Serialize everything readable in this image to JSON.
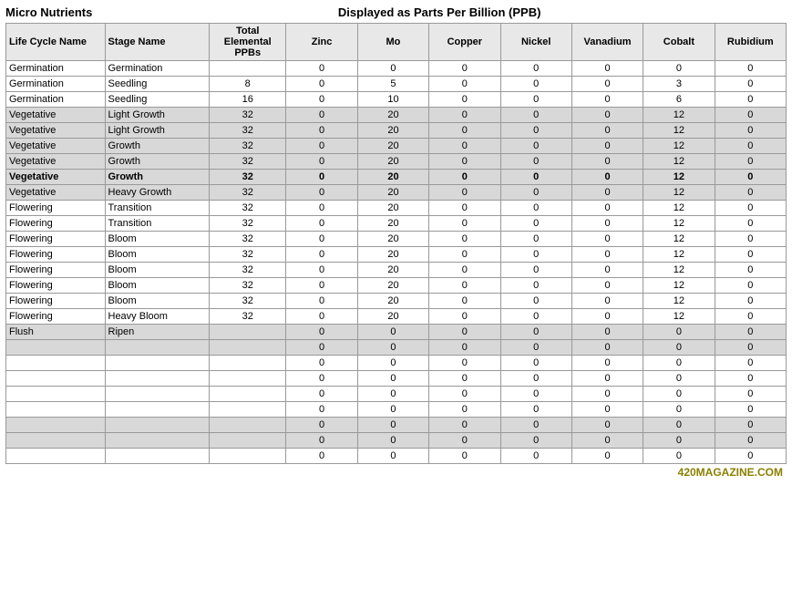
{
  "header": {
    "left_title": "Micro Nutrients",
    "right_title": "Displayed as Parts Per Billion (PPB)"
  },
  "columns": {
    "lifecycle": "Life Cycle Name",
    "stage": "Stage Name",
    "total": "Total Elemental PPBs",
    "zinc": "Zinc",
    "mo": "Mo",
    "copper": "Copper",
    "nickel": "Nickel",
    "vanadium": "Vanadium",
    "cobalt": "Cobalt",
    "rubidium": "Rubidium"
  },
  "rows": [
    {
      "lifecycle": "Germination",
      "stage": "Germination",
      "total": "",
      "zinc": "0",
      "mo": "0",
      "copper": "0",
      "nickel": "0",
      "vanadium": "0",
      "cobalt": "0",
      "rubidium": "0",
      "shade": false
    },
    {
      "lifecycle": "Germination",
      "stage": "Seedling",
      "total": "8",
      "zinc": "0",
      "mo": "5",
      "copper": "0",
      "nickel": "0",
      "vanadium": "0",
      "cobalt": "3",
      "rubidium": "0",
      "shade": false
    },
    {
      "lifecycle": "Germination",
      "stage": "Seedling",
      "total": "16",
      "zinc": "0",
      "mo": "10",
      "copper": "0",
      "nickel": "0",
      "vanadium": "0",
      "cobalt": "6",
      "rubidium": "0",
      "shade": false
    },
    {
      "lifecycle": "Vegetative",
      "stage": "Light Growth",
      "total": "32",
      "zinc": "0",
      "mo": "20",
      "copper": "0",
      "nickel": "0",
      "vanadium": "0",
      "cobalt": "12",
      "rubidium": "0",
      "shade": true
    },
    {
      "lifecycle": "Vegetative",
      "stage": "Light Growth",
      "total": "32",
      "zinc": "0",
      "mo": "20",
      "copper": "0",
      "nickel": "0",
      "vanadium": "0",
      "cobalt": "12",
      "rubidium": "0",
      "shade": true
    },
    {
      "lifecycle": "Vegetative",
      "stage": "Growth",
      "total": "32",
      "zinc": "0",
      "mo": "20",
      "copper": "0",
      "nickel": "0",
      "vanadium": "0",
      "cobalt": "12",
      "rubidium": "0",
      "shade": true
    },
    {
      "lifecycle": "Vegetative",
      "stage": "Growth",
      "total": "32",
      "zinc": "0",
      "mo": "20",
      "copper": "0",
      "nickel": "0",
      "vanadium": "0",
      "cobalt": "12",
      "rubidium": "0",
      "shade": true
    },
    {
      "lifecycle": "Vegetative",
      "stage": "Growth",
      "total": "32",
      "zinc": "0",
      "mo": "20",
      "copper": "0",
      "nickel": "0",
      "vanadium": "0",
      "cobalt": "12",
      "rubidium": "0",
      "shade": true,
      "bold": true
    },
    {
      "lifecycle": "Vegetative",
      "stage": "Heavy Growth",
      "total": "32",
      "zinc": "0",
      "mo": "20",
      "copper": "0",
      "nickel": "0",
      "vanadium": "0",
      "cobalt": "12",
      "rubidium": "0",
      "shade": true
    },
    {
      "lifecycle": "Flowering",
      "stage": "Transition",
      "total": "32",
      "zinc": "0",
      "mo": "20",
      "copper": "0",
      "nickel": "0",
      "vanadium": "0",
      "cobalt": "12",
      "rubidium": "0",
      "shade": false
    },
    {
      "lifecycle": "Flowering",
      "stage": "Transition",
      "total": "32",
      "zinc": "0",
      "mo": "20",
      "copper": "0",
      "nickel": "0",
      "vanadium": "0",
      "cobalt": "12",
      "rubidium": "0",
      "shade": false
    },
    {
      "lifecycle": "Flowering",
      "stage": "Bloom",
      "total": "32",
      "zinc": "0",
      "mo": "20",
      "copper": "0",
      "nickel": "0",
      "vanadium": "0",
      "cobalt": "12",
      "rubidium": "0",
      "shade": false
    },
    {
      "lifecycle": "Flowering",
      "stage": "Bloom",
      "total": "32",
      "zinc": "0",
      "mo": "20",
      "copper": "0",
      "nickel": "0",
      "vanadium": "0",
      "cobalt": "12",
      "rubidium": "0",
      "shade": false
    },
    {
      "lifecycle": "Flowering",
      "stage": "Bloom",
      "total": "32",
      "zinc": "0",
      "mo": "20",
      "copper": "0",
      "nickel": "0",
      "vanadium": "0",
      "cobalt": "12",
      "rubidium": "0",
      "shade": false
    },
    {
      "lifecycle": "Flowering",
      "stage": "Bloom",
      "total": "32",
      "zinc": "0",
      "mo": "20",
      "copper": "0",
      "nickel": "0",
      "vanadium": "0",
      "cobalt": "12",
      "rubidium": "0",
      "shade": false
    },
    {
      "lifecycle": "Flowering",
      "stage": "Bloom",
      "total": "32",
      "zinc": "0",
      "mo": "20",
      "copper": "0",
      "nickel": "0",
      "vanadium": "0",
      "cobalt": "12",
      "rubidium": "0",
      "shade": false
    },
    {
      "lifecycle": "Flowering",
      "stage": "Heavy Bloom",
      "total": "32",
      "zinc": "0",
      "mo": "20",
      "copper": "0",
      "nickel": "0",
      "vanadium": "0",
      "cobalt": "12",
      "rubidium": "0",
      "shade": false
    },
    {
      "lifecycle": "Flush",
      "stage": "Ripen",
      "total": "",
      "zinc": "0",
      "mo": "0",
      "copper": "0",
      "nickel": "0",
      "vanadium": "0",
      "cobalt": "0",
      "rubidium": "0",
      "shade": true
    },
    {
      "lifecycle": "",
      "stage": "",
      "total": "",
      "zinc": "0",
      "mo": "0",
      "copper": "0",
      "nickel": "0",
      "vanadium": "0",
      "cobalt": "0",
      "rubidium": "0",
      "shade": true
    },
    {
      "lifecycle": "",
      "stage": "",
      "total": "",
      "zinc": "0",
      "mo": "0",
      "copper": "0",
      "nickel": "0",
      "vanadium": "0",
      "cobalt": "0",
      "rubidium": "0",
      "shade": false
    },
    {
      "lifecycle": "",
      "stage": "",
      "total": "",
      "zinc": "0",
      "mo": "0",
      "copper": "0",
      "nickel": "0",
      "vanadium": "0",
      "cobalt": "0",
      "rubidium": "0",
      "shade": false
    },
    {
      "lifecycle": "",
      "stage": "",
      "total": "",
      "zinc": "0",
      "mo": "0",
      "copper": "0",
      "nickel": "0",
      "vanadium": "0",
      "cobalt": "0",
      "rubidium": "0",
      "shade": false
    },
    {
      "lifecycle": "",
      "stage": "",
      "total": "",
      "zinc": "0",
      "mo": "0",
      "copper": "0",
      "nickel": "0",
      "vanadium": "0",
      "cobalt": "0",
      "rubidium": "0",
      "shade": false
    },
    {
      "lifecycle": "",
      "stage": "",
      "total": "",
      "zinc": "0",
      "mo": "0",
      "copper": "0",
      "nickel": "0",
      "vanadium": "0",
      "cobalt": "0",
      "rubidium": "0",
      "shade": true
    },
    {
      "lifecycle": "",
      "stage": "",
      "total": "",
      "zinc": "0",
      "mo": "0",
      "copper": "0",
      "nickel": "0",
      "vanadium": "0",
      "cobalt": "0",
      "rubidium": "0",
      "shade": true
    },
    {
      "lifecycle": "",
      "stage": "",
      "total": "",
      "zinc": "0",
      "mo": "0",
      "copper": "0",
      "nickel": "0",
      "vanadium": "0",
      "cobalt": "0",
      "rubidium": "0",
      "shade": false
    }
  ],
  "watermark": "420MAGAZINE.COM"
}
